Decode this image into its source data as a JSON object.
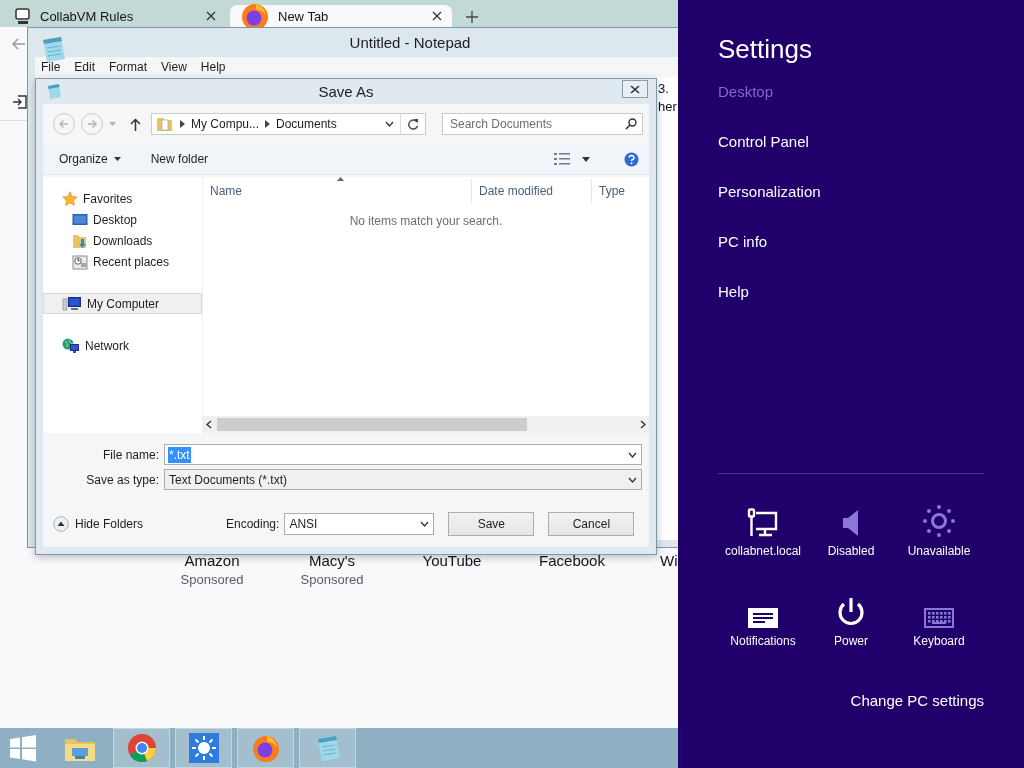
{
  "browser": {
    "tabs": [
      {
        "label": "CollabVM Rules",
        "kind": "vm",
        "selected": false
      },
      {
        "label": "New Tab",
        "kind": "firefox",
        "selected": true
      }
    ],
    "shortcuts": [
      {
        "name": "Amazon",
        "note": "Sponsored"
      },
      {
        "name": "Macy's",
        "note": "Sponsored"
      },
      {
        "name": "YouTube"
      },
      {
        "name": "Facebook"
      },
      {
        "name": "Wi"
      }
    ]
  },
  "notepad": {
    "title": "Untitled - Notepad",
    "menu": [
      "File",
      "Edit",
      "Format",
      "View",
      "Help"
    ],
    "text_lines": [
      "3.",
      "her"
    ]
  },
  "save_as": {
    "title": "Save As",
    "path": [
      "My Compu...",
      "Documents"
    ],
    "search": {
      "placeholder": "Search Documents"
    },
    "toolbar": {
      "organize": "Organize",
      "new_folder": "New folder"
    },
    "nav": [
      {
        "label": "Favorites",
        "kind": "star",
        "selected": false,
        "children": [
          {
            "label": "Desktop",
            "kind": "desktop",
            "selected": false
          },
          {
            "label": "Downloads",
            "kind": "downloads",
            "selected": false
          },
          {
            "label": "Recent places",
            "kind": "recent",
            "selected": false
          }
        ]
      },
      {
        "label": "My Computer",
        "kind": "computer",
        "selected": true
      },
      {
        "label": "Network",
        "kind": "network",
        "selected": false
      }
    ],
    "columns": [
      "Name",
      "Date modified",
      "Type"
    ],
    "empty_message": "No items match your search.",
    "file_name": {
      "label": "File name:",
      "value": "*.txt",
      "value_selected": true
    },
    "save_type": {
      "label": "Save as type:",
      "value": "Text Documents (*.txt)"
    },
    "hide_folders": "Hide Folders",
    "encoding": {
      "label": "Encoding:",
      "value": "ANSI"
    },
    "buttons": [
      "Save",
      "Cancel"
    ]
  },
  "taskbar": {
    "apps": [
      {
        "kind": "start",
        "running": false
      },
      {
        "kind": "files",
        "running": false
      },
      {
        "kind": "chrome",
        "running": true
      },
      {
        "kind": "weather",
        "running": true
      },
      {
        "kind": "firefox",
        "running": true
      },
      {
        "kind": "notepad",
        "running": true
      }
    ]
  },
  "charms": {
    "title": "Settings",
    "links": [
      {
        "label": "Desktop",
        "disabled": true
      },
      {
        "label": "Control Panel",
        "disabled": false
      },
      {
        "label": "Personalization",
        "disabled": false
      },
      {
        "label": "PC info",
        "disabled": false
      },
      {
        "label": "Help",
        "disabled": false
      }
    ],
    "tiles": [
      {
        "label": "collabnet.local",
        "kind": "network",
        "disabled": false
      },
      {
        "label": "Disabled",
        "kind": "volume",
        "disabled": true
      },
      {
        "label": "Unavailable",
        "kind": "brightness",
        "disabled": true
      },
      {
        "label": "Notifications",
        "kind": "notifications",
        "disabled": false
      },
      {
        "label": "Power",
        "kind": "power",
        "disabled": false
      },
      {
        "label": "Keyboard",
        "kind": "keyboard",
        "disabled": true
      }
    ],
    "footer": "Change PC settings"
  }
}
